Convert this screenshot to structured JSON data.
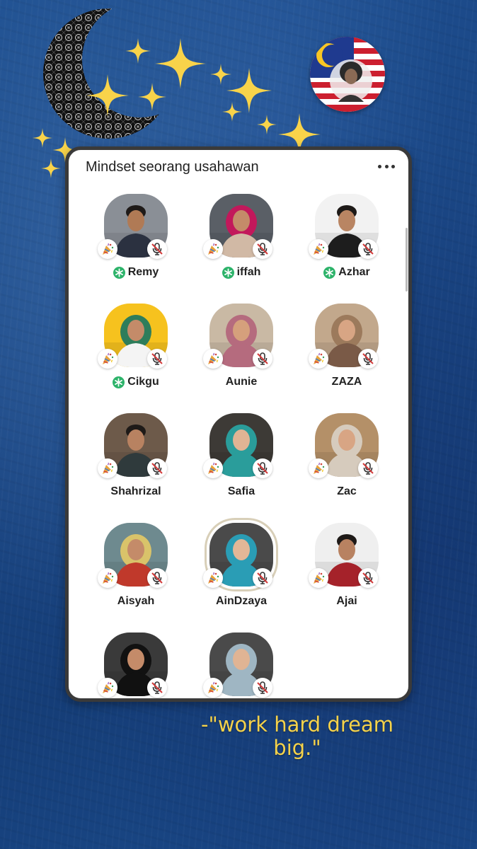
{
  "room": {
    "title": "Mindset seorang usahawan",
    "more_icon": "more-dots-icon"
  },
  "speakers": [
    {
      "name": "Remy",
      "moderator": true,
      "bg": "#8a8f96",
      "skin": "#b07a55",
      "cloth": "#2b3140",
      "head": "none"
    },
    {
      "name": "iffah",
      "moderator": true,
      "bg": "#5a5f66",
      "skin": "#c48b69",
      "cloth": "#d1b9a5",
      "head": "#c2185b"
    },
    {
      "name": "Azhar",
      "moderator": true,
      "bg": "#f2f2f2",
      "skin": "#b98563",
      "cloth": "#1d1d1d",
      "head": "none"
    },
    {
      "name": "Cikgu",
      "moderator": true,
      "bg": "#f6c21e",
      "skin": "#c48b69",
      "cloth": "#f4f4f4",
      "head": "#2e7d5b"
    },
    {
      "name": "Aunie",
      "moderator": false,
      "bg": "#c9b9a4",
      "skin": "#d5a07c",
      "cloth": "#b56b7e",
      "head": "#b56b7e"
    },
    {
      "name": "ZAZA",
      "moderator": false,
      "bg": "#c2a88c",
      "skin": "#d8a584",
      "cloth": "#7a5a47",
      "head": "#9c7a5c"
    },
    {
      "name": "Shahrizal",
      "moderator": false,
      "bg": "#6d5a4a",
      "skin": "#b88261",
      "cloth": "#2f3a3c",
      "head": "none"
    },
    {
      "name": "Safia",
      "moderator": false,
      "bg": "#3d3a36",
      "skin": "#e0b494",
      "cloth": "#2a9d9b",
      "head": "#2a9d9b"
    },
    {
      "name": "Zac",
      "moderator": false,
      "bg": "#b49068",
      "skin": "#d8a584",
      "cloth": "#d6cbbd",
      "head": "#d6cbbd"
    },
    {
      "name": "Aisyah",
      "moderator": false,
      "bg": "#6e8a8f",
      "skin": "#c48b69",
      "cloth": "#c0392b",
      "head": "#d9c36a"
    },
    {
      "name": "AinDzaya",
      "moderator": false,
      "bg": "#4a4a4a",
      "skin": "#e2b797",
      "cloth": "#2a9db5",
      "head": "#2a9db5",
      "highlight": true
    },
    {
      "name": "Ajai",
      "moderator": false,
      "bg": "#efefef",
      "skin": "#b88261",
      "cloth": "#a5222a",
      "head": "none"
    },
    {
      "name": "",
      "moderator": false,
      "bg": "#3a3a3a",
      "skin": "#c48b69",
      "cloth": "#111111",
      "head": "#111111"
    },
    {
      "name": "",
      "moderator": false,
      "bg": "#4a4a4a",
      "skin": "#e0b494",
      "cloth": "#9fb6c3",
      "head": "#9fb6c3"
    }
  ],
  "badges": {
    "party_icon": "party-popper-icon",
    "mute_icon": "muted-microphone-icon",
    "moderator_icon": "moderator-star-icon"
  },
  "quote": {
    "line1": "-\"work hard dream",
    "line2": "big.\""
  },
  "colors": {
    "background": "#1a4684",
    "moderator_green": "#2db36a",
    "mute_red": "#d23a3a",
    "quote_yellow": "#f5d24a"
  }
}
